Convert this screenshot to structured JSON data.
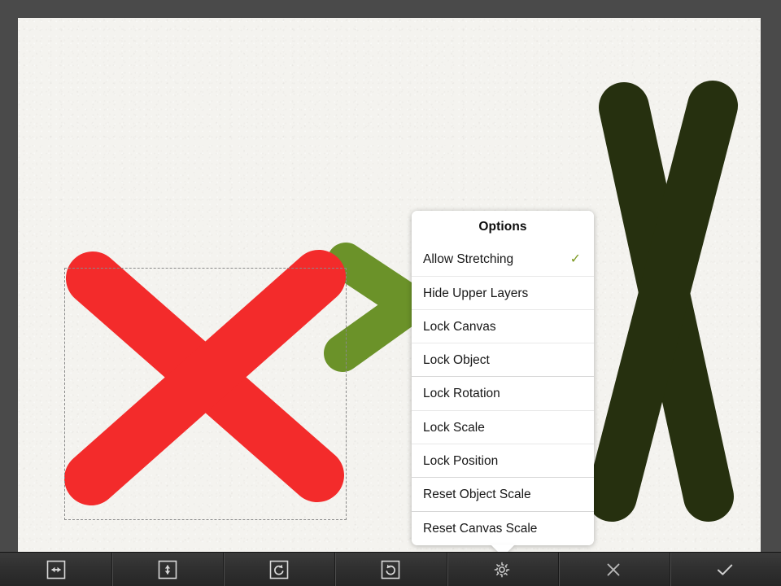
{
  "app": {
    "canvas_background": "#f4f3ef",
    "frame_color": "#4a4a4a"
  },
  "canvas": {
    "shapes": [
      {
        "name": "red-x-stroke",
        "kind": "x-mark",
        "color": "#f32b2b",
        "selected": true
      },
      {
        "name": "green-chevron-stroke",
        "kind": "chevron-right",
        "color": "#6b9229",
        "selected": false
      },
      {
        "name": "dark-green-x-stroke",
        "kind": "x-mark",
        "color": "#26300f",
        "selected": false
      }
    ],
    "selection": {
      "visible": true,
      "style": "dashed",
      "color": "#8a8a8a"
    }
  },
  "popover": {
    "title": "Options",
    "groups": [
      {
        "items": [
          {
            "label": "Allow Stretching",
            "checked": true,
            "check_glyph": "✓"
          },
          {
            "label": "Hide Upper Layers",
            "checked": false,
            "check_glyph": "✓"
          },
          {
            "label": "Lock Canvas",
            "checked": false,
            "check_glyph": "✓"
          },
          {
            "label": "Lock Object",
            "checked": false,
            "check_glyph": "✓"
          }
        ]
      },
      {
        "items": [
          {
            "label": "Lock Rotation",
            "checked": false,
            "check_glyph": "✓"
          },
          {
            "label": "Lock Scale",
            "checked": false,
            "check_glyph": "✓"
          },
          {
            "label": "Lock Position",
            "checked": false,
            "check_glyph": "✓"
          }
        ]
      },
      {
        "items": [
          {
            "label": "Reset Object Scale",
            "checked": false,
            "check_glyph": "✓"
          }
        ]
      },
      {
        "items": [
          {
            "label": "Reset Canvas Scale",
            "checked": false,
            "check_glyph": "✓"
          }
        ]
      }
    ],
    "check_color": "#7d9a22",
    "background": "#ffffff"
  },
  "toolbar": {
    "background": "#303030",
    "icon_color": "#d8d8d8",
    "buttons": [
      {
        "icon": "flip-horizontal-icon",
        "label": "Flip Horizontal"
      },
      {
        "icon": "flip-vertical-icon",
        "label": "Flip Vertical"
      },
      {
        "icon": "rotate-counterclockwise-icon",
        "label": "Rotate Left"
      },
      {
        "icon": "rotate-clockwise-icon",
        "label": "Rotate Right"
      },
      {
        "icon": "gear-icon",
        "label": "Options"
      },
      {
        "icon": "close-icon",
        "label": "Cancel"
      },
      {
        "icon": "check-icon",
        "label": "Confirm"
      }
    ]
  }
}
